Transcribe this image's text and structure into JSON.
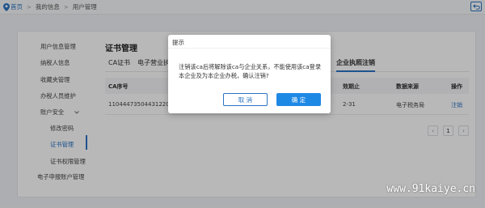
{
  "breadcrumb": {
    "items": [
      "首页",
      "我的信息",
      "用户管理"
    ],
    "separator": ">"
  },
  "sidebar": {
    "items": [
      {
        "label": "用户信息管理"
      },
      {
        "label": "纳税人信息"
      },
      {
        "label": "收藏夹管理"
      },
      {
        "label": "办税人员维护"
      },
      {
        "label": "账户安全"
      },
      {
        "label": "修改密码"
      },
      {
        "label": "证书管理"
      },
      {
        "label": "证书权限管理"
      },
      {
        "label": "电子申报账户管理"
      }
    ]
  },
  "content": {
    "title": "证书管理",
    "tabs": [
      "CA证书",
      "电子营业执照",
      "企业执照注销"
    ]
  },
  "table": {
    "columns": [
      "CA序号",
      "效期止",
      "数据来源",
      "操作"
    ],
    "rows": [
      {
        "ca_no": "110444735044312205...",
        "expiry": "2-31",
        "source": "电子税务局",
        "action": "注销"
      }
    ]
  },
  "pager": {
    "prev": "‹",
    "page": "1",
    "next": "›"
  },
  "dialog": {
    "title": "提示",
    "message": "注销该ca后将解除该ca与企业关系，不能使用该ca登录本企业及为本企业办税，确认注销?",
    "cancel_label": "取 消",
    "confirm_label": "确 定"
  },
  "watermark": "www.91kaiye.cn",
  "colors": {
    "accent": "#1e88e5",
    "link": "#2a73c4"
  }
}
